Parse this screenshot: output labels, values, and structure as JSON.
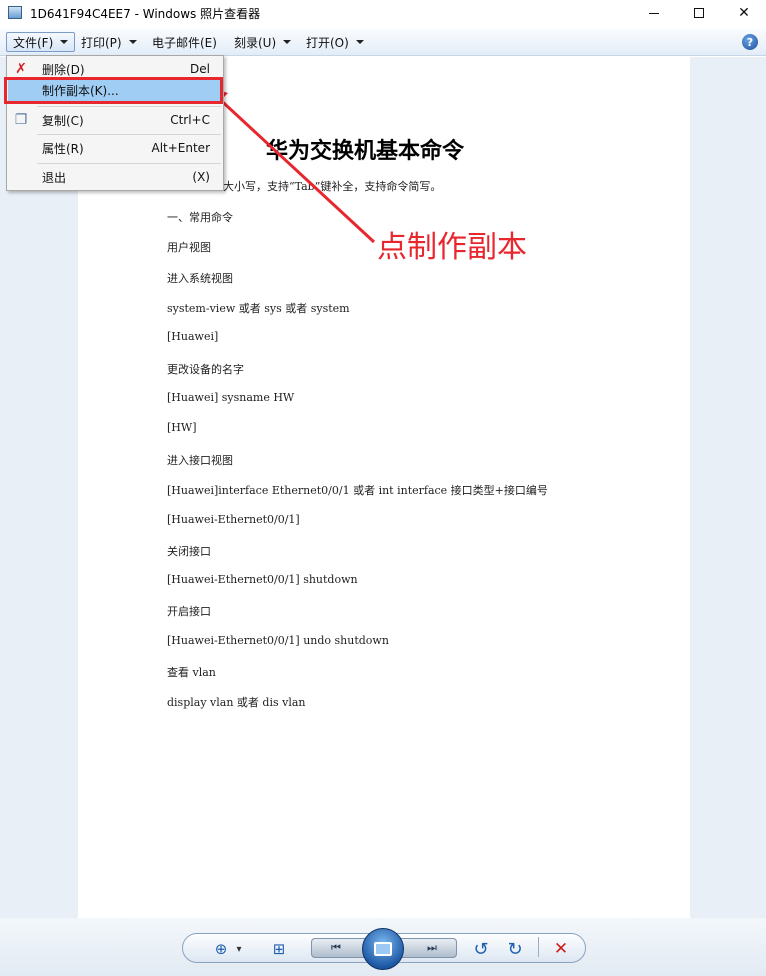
{
  "window": {
    "title": "1D641F94C4EE7 - Windows 照片查看器",
    "minimize_label": "—",
    "close_label": "✕"
  },
  "menubar": {
    "items": [
      {
        "label": "文件(F)"
      },
      {
        "label": "打印(P)"
      },
      {
        "label": "电子邮件(E)"
      },
      {
        "label": "刻录(U)"
      },
      {
        "label": "打开(O)"
      }
    ],
    "help_glyph": "?"
  },
  "file_menu": {
    "items": [
      {
        "label": "删除(D)",
        "shortcut": "Del",
        "icon": "delete-x-icon"
      },
      {
        "label": "制作副本(K)...",
        "shortcut": "",
        "icon": ""
      },
      {
        "label": "复制(C)",
        "shortcut": "Ctrl+C",
        "icon": "copy-icon"
      },
      {
        "label": "属性(R)",
        "shortcut": "Alt+Enter",
        "icon": ""
      },
      {
        "label": "退出",
        "shortcut": "(X)",
        "icon": ""
      }
    ],
    "highlighted_index": 1
  },
  "document": {
    "title": "华为交换机基本命令",
    "subtitle": "大小写，支持“Tab”键补全，支持命令简写。",
    "lines": [
      "一、常用命令",
      "用户视图",
      "进入系统视图",
      "system-view 或者 sys 或者 system",
      "[Huawei]",
      "更改设备的名字",
      "[Huawei] sysname HW",
      "[HW]",
      "进入接口视图",
      "[Huawei]interface Ethernet0/0/1 或者 int interface 接口类型+接口编号",
      "[Huawei-Ethernet0/0/1]",
      "关闭接口",
      "[Huawei-Ethernet0/0/1] shutdown",
      "开启接口",
      "[Huawei-Ethernet0/0/1] undo shutdown",
      "查看 vlan",
      "display vlan 或者 dis vlan"
    ]
  },
  "annotation": {
    "text": "点制作副本",
    "color": "#e8262e"
  },
  "controls": {
    "zoom_glyph": "⊕",
    "zoom_caret": "▾",
    "fit_glyph": "⊞",
    "prev_glyph": "⏮",
    "next_glyph": "⏭",
    "rotate_ccw_glyph": "↺",
    "rotate_cw_glyph": "↻",
    "delete_glyph": "✕"
  },
  "colors": {
    "accent": "#1d5fb0",
    "highlight": "#9fcdf4",
    "annotation_red": "#e8262e"
  }
}
